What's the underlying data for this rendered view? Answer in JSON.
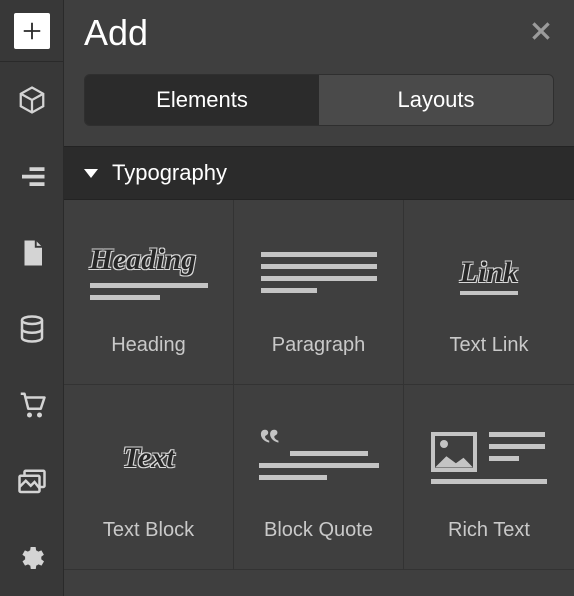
{
  "panel": {
    "title": "Add",
    "tabs": [
      {
        "label": "Elements",
        "active": true
      },
      {
        "label": "Layouts",
        "active": false
      }
    ]
  },
  "section": {
    "title": "Typography"
  },
  "items": [
    {
      "label": "Heading",
      "icon_text": "Heading"
    },
    {
      "label": "Paragraph",
      "icon_text": ""
    },
    {
      "label": "Text Link",
      "icon_text": "Link"
    },
    {
      "label": "Text Block",
      "icon_text": "Text"
    },
    {
      "label": "Block Quote",
      "icon_text": ""
    },
    {
      "label": "Rich Text",
      "icon_text": ""
    }
  ],
  "rail": {
    "items": [
      "add",
      "blocks",
      "structure",
      "pages",
      "cms",
      "ecommerce",
      "assets",
      "settings"
    ]
  }
}
